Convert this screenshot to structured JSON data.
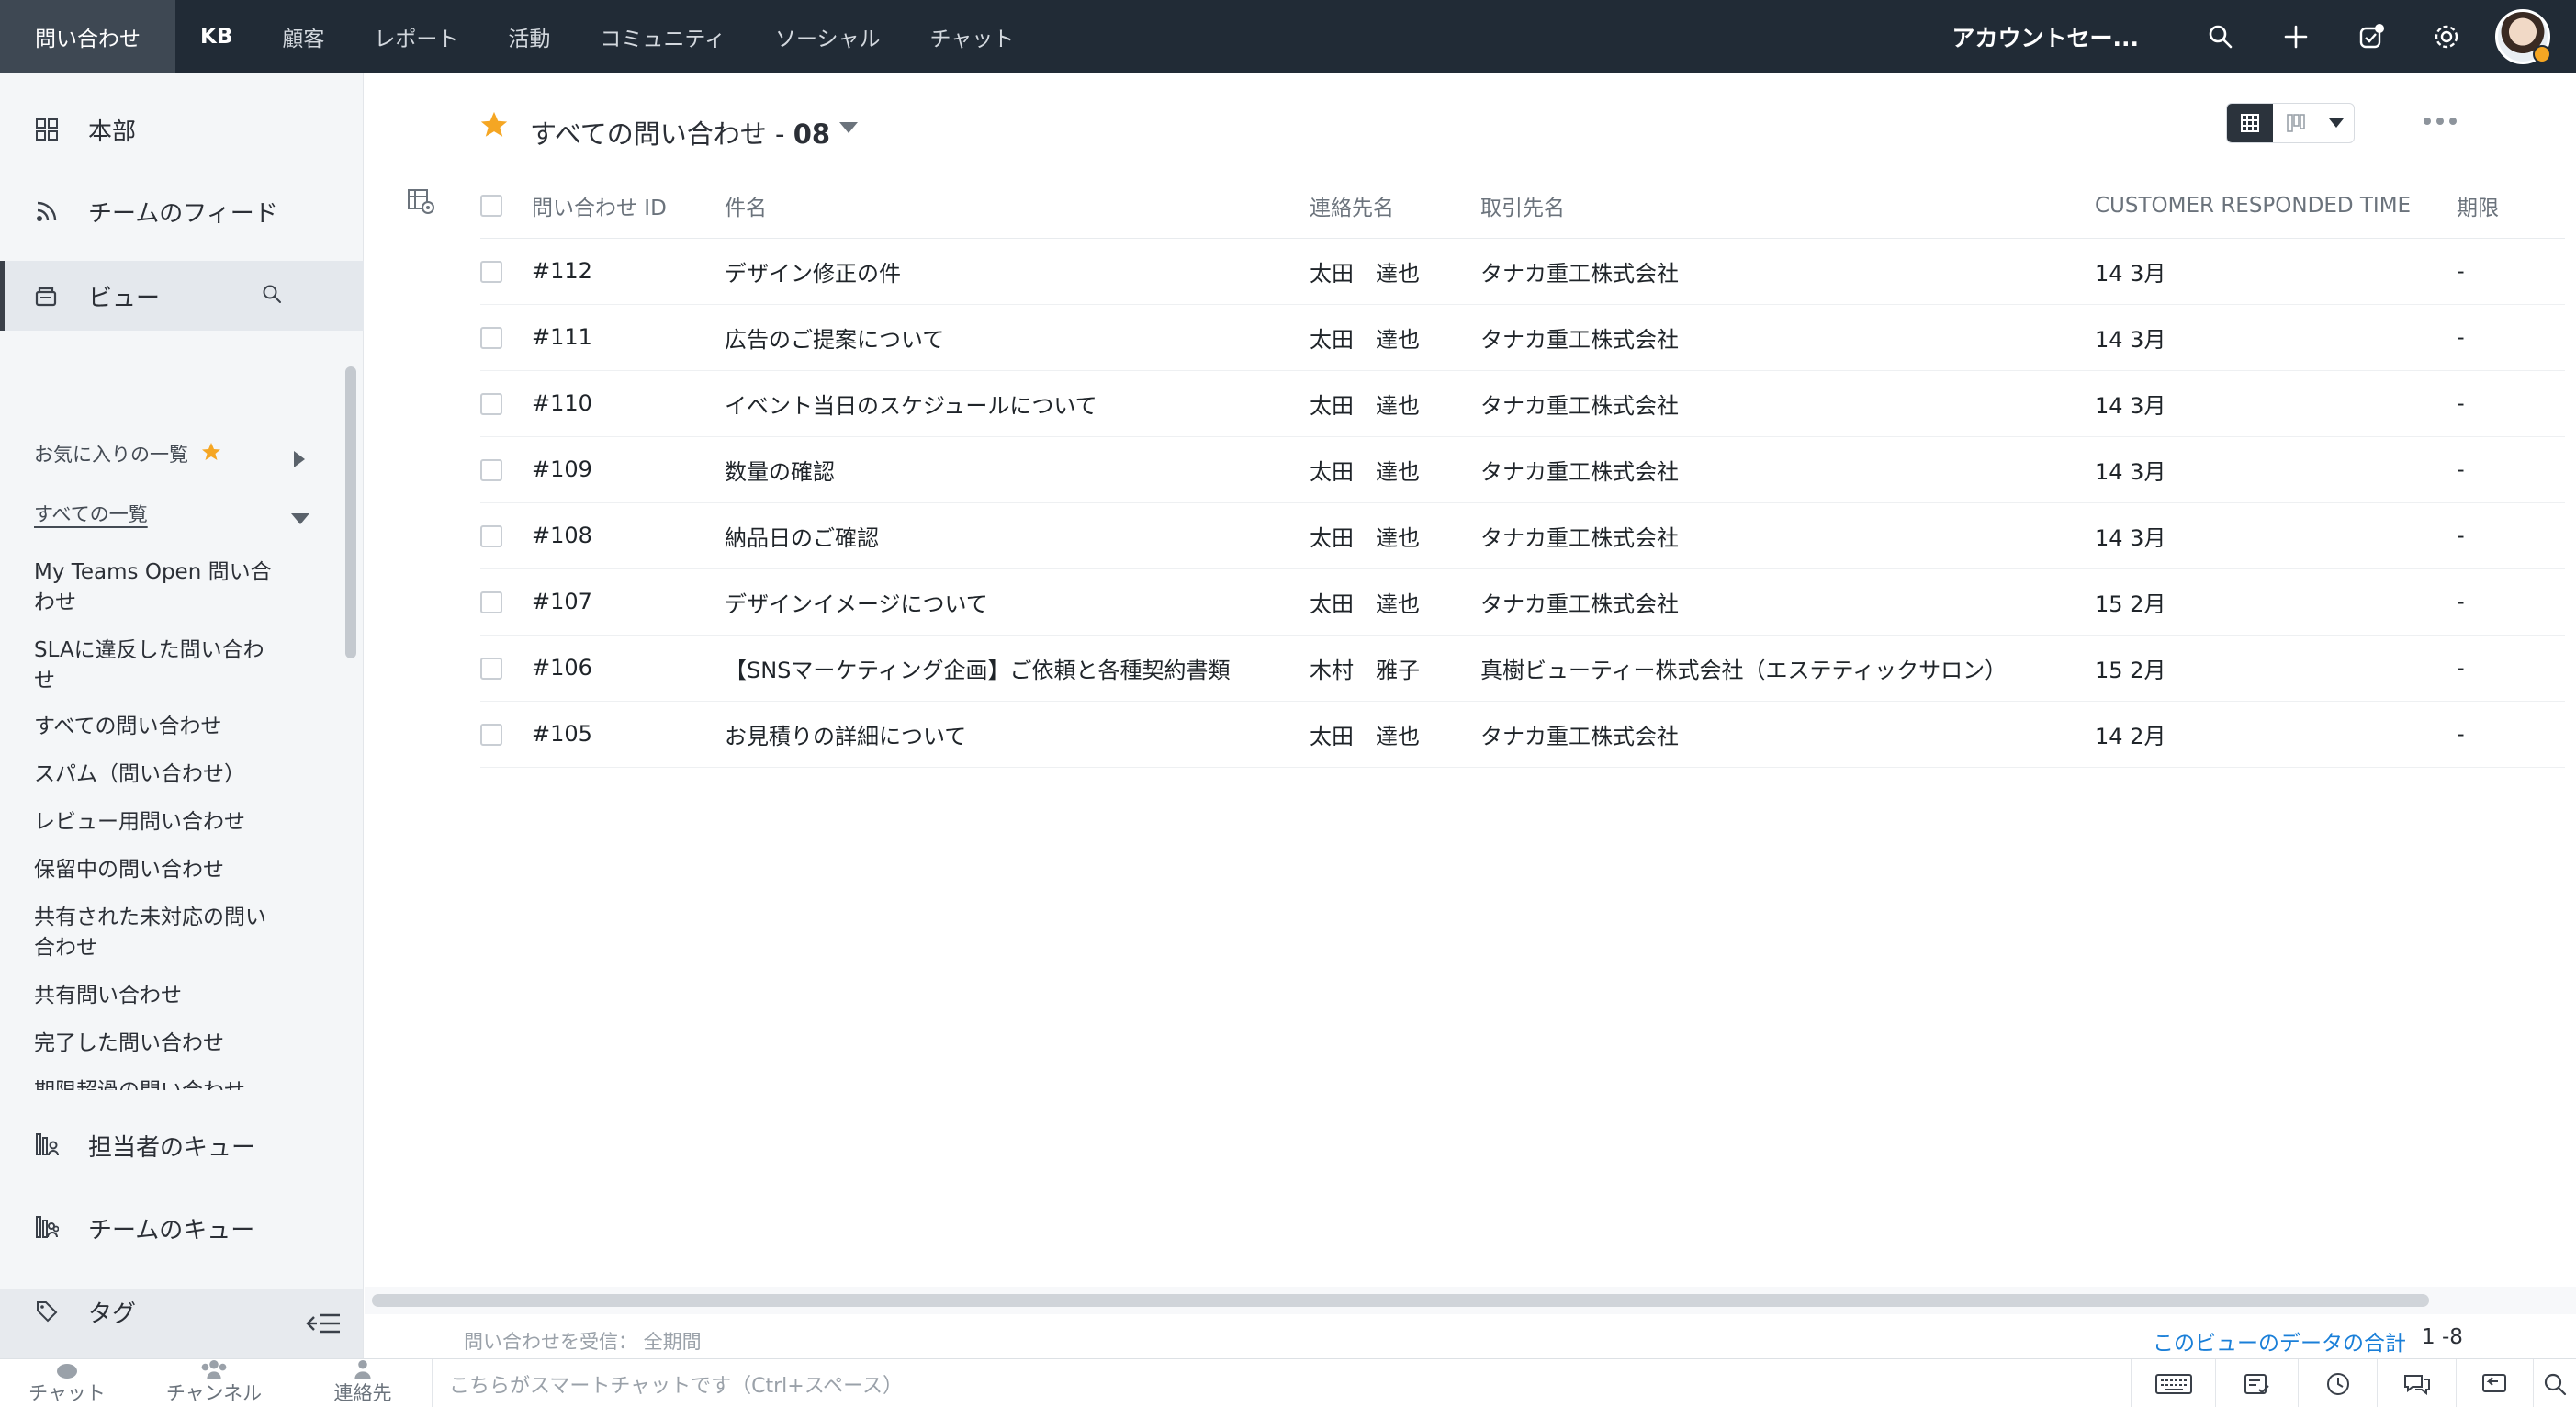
{
  "topnav": {
    "tabs": [
      "問い合わせ",
      "KB",
      "顧客",
      "レポート",
      "活動",
      "コミュニティ",
      "ソーシャル",
      "チャット"
    ],
    "account": "アカウントセー..."
  },
  "sidebar": {
    "home": "本部",
    "team_feed": "チームのフィード",
    "views": "ビュー",
    "favorites_heading": "お気に入りの一覧",
    "all_heading": "すべての一覧",
    "view_items": [
      "My Teams Open 問い合わせ",
      "SLAに違反した問い合わせ",
      "すべての問い合わせ",
      "スパム（問い合わせ）",
      "レビュー用問い合わせ",
      "保留中の問い合わせ",
      "共有された未対応の問い合わせ",
      "共有問い合わせ",
      "完了した問い合わせ",
      "期限超過の問い合わせ"
    ],
    "agent_queue": "担当者のキュー",
    "team_queue": "チームのキュー",
    "tags": "タグ"
  },
  "main": {
    "title": "すべての問い合わせ - ",
    "count": "08",
    "columns": [
      "問い合わせ ID",
      "件名",
      "連絡先名",
      "取引先名",
      "CUSTOMER RESPONDED TIME",
      "期限"
    ],
    "rows": [
      {
        "id": "#112",
        "subject": "デザイン修正の件",
        "contact": "太田　達也",
        "account": "タナカ重工株式会社",
        "responded": "14 3月",
        "due": "-"
      },
      {
        "id": "#111",
        "subject": "広告のご提案について",
        "contact": "太田　達也",
        "account": "タナカ重工株式会社",
        "responded": "14 3月",
        "due": "-"
      },
      {
        "id": "#110",
        "subject": "イベント当日のスケジュールについて",
        "contact": "太田　達也",
        "account": "タナカ重工株式会社",
        "responded": "14 3月",
        "due": "-"
      },
      {
        "id": "#109",
        "subject": "数量の確認",
        "contact": "太田　達也",
        "account": "タナカ重工株式会社",
        "responded": "14 3月",
        "due": "-"
      },
      {
        "id": "#108",
        "subject": "納品日のご確認",
        "contact": "太田　達也",
        "account": "タナカ重工株式会社",
        "responded": "14 3月",
        "due": "-"
      },
      {
        "id": "#107",
        "subject": "デザインイメージについて",
        "contact": "太田　達也",
        "account": "タナカ重工株式会社",
        "responded": "15 2月",
        "due": "-"
      },
      {
        "id": "#106",
        "subject": "【SNSマーケティング企画】ご依頼と各種契約書類",
        "contact": "木村　雅子",
        "account": "真樹ビューティー株式会社（エステティックサロン）",
        "responded": "15 2月",
        "due": "-"
      },
      {
        "id": "#105",
        "subject": "お見積りの詳細について",
        "contact": "太田　達也",
        "account": "タナカ重工株式会社",
        "responded": "14 2月",
        "due": "-"
      }
    ],
    "footer_received": "問い合わせを受信：  全期間",
    "footer_total_link": "このビューのデータの合計",
    "footer_range": "1 -8"
  },
  "bottombar": {
    "chat": "チャット",
    "channel": "チャンネル",
    "contacts": "連絡先",
    "smart_chat_placeholder": "こちらがスマートチャットです（Ctrl+スペース）"
  },
  "colors": {
    "nav_bg": "#212b36",
    "accent_star": "#f5a623",
    "link_blue": "#1a7fd8"
  }
}
